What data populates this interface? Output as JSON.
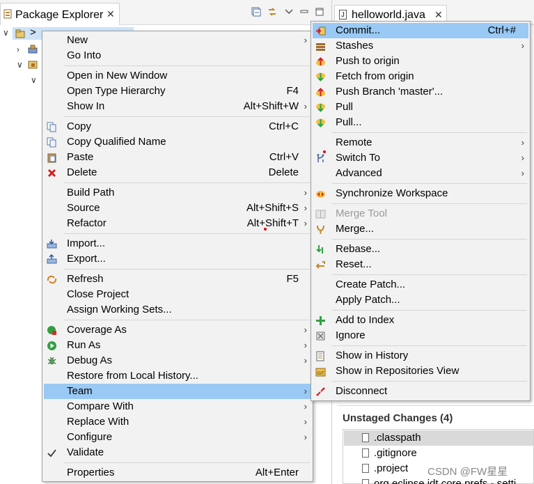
{
  "package_explorer": {
    "title": "Package Explorer",
    "project_prefix": ">"
  },
  "editor": {
    "tab_title": "helloworld.java"
  },
  "staging": {
    "unstaged_title": "Unstaged Changes (4)",
    "files": [
      ".classpath",
      ".gitignore",
      ".project",
      "org.eclipse.jdt.core.prefs - setti"
    ]
  },
  "context_menu": {
    "items": [
      {
        "label": "New",
        "shortcut": "",
        "submenu": true
      },
      {
        "label": "Go Into",
        "shortcut": ""
      },
      {
        "label": "Open in New Window",
        "shortcut": ""
      },
      {
        "label": "Open Type Hierarchy",
        "shortcut": "F4"
      },
      {
        "label": "Show In",
        "shortcut": "Alt+Shift+W",
        "submenu": true
      },
      {
        "label": "Copy",
        "shortcut": "Ctrl+C",
        "icon": "copy-icon"
      },
      {
        "label": "Copy Qualified Name",
        "shortcut": "",
        "icon": "copy-qualified-icon"
      },
      {
        "label": "Paste",
        "shortcut": "Ctrl+V",
        "icon": "paste-icon"
      },
      {
        "label": "Delete",
        "shortcut": "Delete",
        "icon": "delete-icon"
      },
      {
        "label": "Build Path",
        "shortcut": "",
        "submenu": true
      },
      {
        "label": "Source",
        "shortcut": "Alt+Shift+S",
        "submenu": true
      },
      {
        "label": "Refactor",
        "shortcut": "Alt+Shift+T",
        "submenu": true
      },
      {
        "label": "Import...",
        "shortcut": "",
        "icon": "import-icon"
      },
      {
        "label": "Export...",
        "shortcut": "",
        "icon": "export-icon"
      },
      {
        "label": "Refresh",
        "shortcut": "F5",
        "icon": "refresh-icon"
      },
      {
        "label": "Close Project",
        "shortcut": ""
      },
      {
        "label": "Assign Working Sets...",
        "shortcut": ""
      },
      {
        "label": "Coverage As",
        "shortcut": "",
        "submenu": true,
        "icon": "coverage-icon"
      },
      {
        "label": "Run As",
        "shortcut": "",
        "submenu": true,
        "icon": "run-icon"
      },
      {
        "label": "Debug As",
        "shortcut": "",
        "submenu": true,
        "icon": "debug-icon"
      },
      {
        "label": "Restore from Local History...",
        "shortcut": ""
      },
      {
        "label": "Team",
        "shortcut": "",
        "submenu": true,
        "highlighted": true
      },
      {
        "label": "Compare With",
        "shortcut": "",
        "submenu": true
      },
      {
        "label": "Replace With",
        "shortcut": "",
        "submenu": true
      },
      {
        "label": "Configure",
        "shortcut": "",
        "submenu": true
      },
      {
        "label": "Validate",
        "shortcut": "",
        "icon": "check-icon"
      },
      {
        "label": "Properties",
        "shortcut": "Alt+Enter"
      }
    ]
  },
  "team_submenu": {
    "items": [
      {
        "label": "Commit...",
        "shortcut": "Ctrl+#",
        "highlighted": true,
        "icon": "commit-icon"
      },
      {
        "label": "Stashes",
        "shortcut": "",
        "submenu": true,
        "icon": "stash-icon"
      },
      {
        "label": "Push to origin",
        "shortcut": "",
        "icon": "push-icon"
      },
      {
        "label": "Fetch from origin",
        "shortcut": "",
        "icon": "fetch-icon"
      },
      {
        "label": "Push Branch 'master'...",
        "shortcut": "",
        "icon": "push-branch-icon"
      },
      {
        "label": "Pull",
        "shortcut": "",
        "icon": "pull-icon"
      },
      {
        "label": "Pull...",
        "shortcut": "",
        "icon": "pull-dialog-icon"
      },
      {
        "label": "Remote",
        "shortcut": "",
        "submenu": true
      },
      {
        "label": "Switch To",
        "shortcut": "",
        "submenu": true,
        "icon": "switch-branch-icon"
      },
      {
        "label": "Advanced",
        "shortcut": "",
        "submenu": true
      },
      {
        "label": "Synchronize Workspace",
        "shortcut": "",
        "icon": "synchronize-icon"
      },
      {
        "label": "Merge Tool",
        "shortcut": "",
        "disabled": true,
        "icon": "merge-tool-icon"
      },
      {
        "label": "Merge...",
        "shortcut": "",
        "icon": "merge-icon"
      },
      {
        "label": "Rebase...",
        "shortcut": "",
        "icon": "rebase-icon"
      },
      {
        "label": "Reset...",
        "shortcut": "",
        "icon": "reset-icon"
      },
      {
        "label": "Create Patch...",
        "shortcut": ""
      },
      {
        "label": "Apply Patch...",
        "shortcut": ""
      },
      {
        "label": "Add to Index",
        "shortcut": "",
        "icon": "add-index-icon"
      },
      {
        "label": "Ignore",
        "shortcut": "",
        "icon": "ignore-icon"
      },
      {
        "label": "Show in History",
        "shortcut": "",
        "icon": "history-icon"
      },
      {
        "label": "Show in Repositories View",
        "shortcut": "",
        "icon": "git-repo-icon"
      },
      {
        "label": "Disconnect",
        "shortcut": "",
        "icon": "disconnect-icon"
      }
    ]
  },
  "watermark": "CSDN @FW星星",
  "colors": {
    "highlight": "#99c9f4",
    "menu_bg": "#f2f2f2"
  }
}
